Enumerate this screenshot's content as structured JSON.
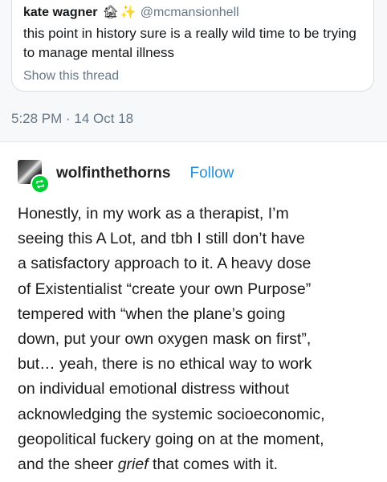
{
  "quote": {
    "author": "kate wagner",
    "emoji": [
      "🏚",
      "✨"
    ],
    "handle": "@mcmansionhell",
    "text": "this point in history sure is a really wild time to be trying to manage mental illness",
    "link": "Show this thread",
    "timestamp": "5:28 PM · 14 Oct 18"
  },
  "post": {
    "username": "wolfinthethorns",
    "follow_label": "Follow",
    "reblog_icon": "reblog-icon",
    "body_lines": [
      "Honestly, in my work as a therapist, I’m",
      "seeing this A Lot, and tbh I still don’t have",
      "a satisfactory approach to it. A heavy dose",
      "of Existentialist “create your own Purpose”",
      "tempered with “when the plane’s going",
      "down, put your own oxygen mask on first”,",
      "but… yeah, there is no ethical way to work",
      "on individual emotional distress without",
      "acknowledging the systemic socioeconomic,",
      "geopolitical fuckery going on at the moment,"
    ],
    "last_line": {
      "before": "and the sheer ",
      "emphasis": "grief",
      "after": " that comes with it."
    }
  },
  "colors": {
    "link_blue": "#2b8fd6",
    "reblog_green": "#00cf35",
    "twitter_gray": "#657786"
  }
}
